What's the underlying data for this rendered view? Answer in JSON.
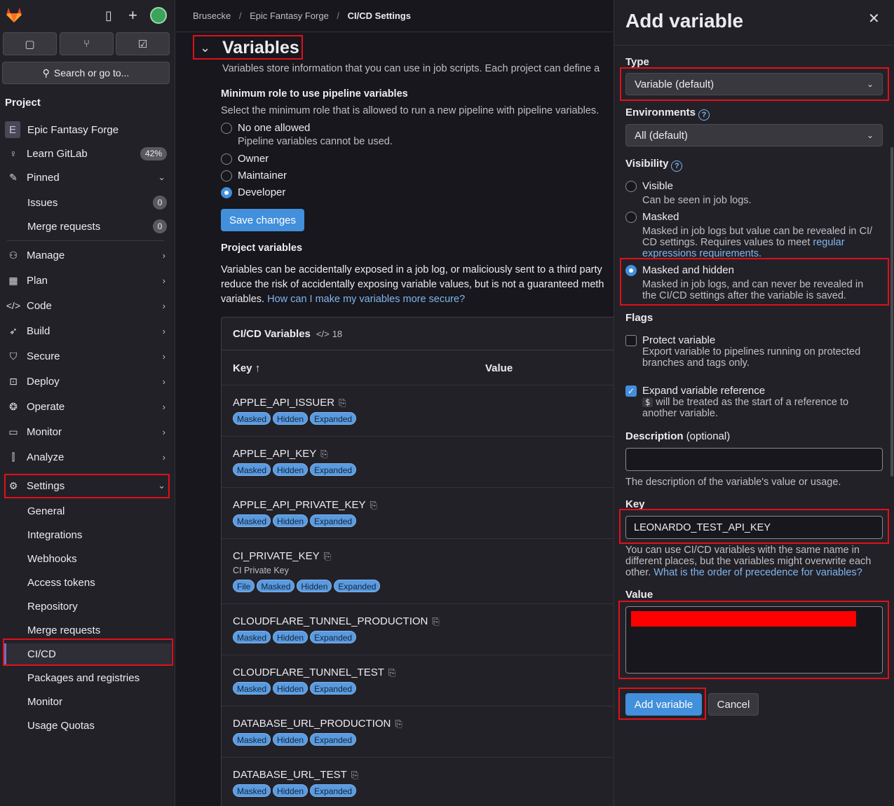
{
  "sidebar": {
    "search_label": "Search or go to...",
    "section_title": "Project",
    "project": {
      "initial": "E",
      "name": "Epic Fantasy Forge"
    },
    "learn": {
      "label": "Learn GitLab",
      "percent": "42%"
    },
    "pinned": {
      "label": "Pinned",
      "items": [
        {
          "label": "Issues",
          "count": "0"
        },
        {
          "label": "Merge requests",
          "count": "0"
        }
      ]
    },
    "nav": [
      "Manage",
      "Plan",
      "Code",
      "Build",
      "Secure",
      "Deploy",
      "Operate",
      "Monitor",
      "Analyze"
    ],
    "settings": {
      "label": "Settings",
      "items": [
        "General",
        "Integrations",
        "Webhooks",
        "Access tokens",
        "Repository",
        "Merge requests",
        "CI/CD",
        "Packages and registries",
        "Monitor",
        "Usage Quotas"
      ]
    }
  },
  "breadcrumb": {
    "items": [
      "Brusecke",
      "Epic Fantasy Forge",
      "CI/CD Settings"
    ]
  },
  "variables_section": {
    "title": "Variables",
    "description": "Variables store information that you can use in job scripts. Each project can define a",
    "min_role": {
      "title": "Minimum role to use pipeline variables",
      "description": "Select the minimum role that is allowed to run a new pipeline with pipeline variables.",
      "options": [
        {
          "label": "No one allowed",
          "help": "Pipeline variables cannot be used.",
          "selected": false
        },
        {
          "label": "Owner",
          "selected": false
        },
        {
          "label": "Maintainer",
          "selected": false
        },
        {
          "label": "Developer",
          "selected": true
        }
      ],
      "save_label": "Save changes"
    },
    "project_vars": {
      "title": "Project variables",
      "line1": "Variables can be accidentally exposed in a job log, or maliciously sent to a third party",
      "line2": "reduce the risk of accidentally exposing variable values, but is not a guaranteed meth",
      "line3_prefix": "variables.",
      "link": "How can I make my variables more secure?"
    },
    "table": {
      "title": "CI/CD Variables",
      "count": "18",
      "col_key": "Key",
      "col_value": "Value",
      "rows": [
        {
          "key": "APPLE_API_ISSUER",
          "badges": [
            "Masked",
            "Hidden",
            "Expanded"
          ]
        },
        {
          "key": "APPLE_API_KEY",
          "badges": [
            "Masked",
            "Hidden",
            "Expanded"
          ]
        },
        {
          "key": "APPLE_API_PRIVATE_KEY",
          "badges": [
            "Masked",
            "Hidden",
            "Expanded"
          ]
        },
        {
          "key": "CI_PRIVATE_KEY",
          "desc": "CI Private Key",
          "badges": [
            "File",
            "Masked",
            "Hidden",
            "Expanded"
          ]
        },
        {
          "key": "CLOUDFLARE_TUNNEL_PRODUCTION",
          "badges": [
            "Masked",
            "Hidden",
            "Expanded"
          ]
        },
        {
          "key": "CLOUDFLARE_TUNNEL_TEST",
          "badges": [
            "Masked",
            "Hidden",
            "Expanded"
          ]
        },
        {
          "key": "DATABASE_URL_PRODUCTION",
          "badges": [
            "Masked",
            "Hidden",
            "Expanded"
          ]
        },
        {
          "key": "DATABASE_URL_TEST",
          "badges": [
            "Masked",
            "Hidden",
            "Expanded"
          ]
        }
      ]
    }
  },
  "drawer": {
    "title": "Add variable",
    "type_label": "Type",
    "type_value": "Variable (default)",
    "env_label": "Environments",
    "env_value": "All (default)",
    "visibility_label": "Visibility",
    "vis_visible": {
      "label": "Visible",
      "help": "Can be seen in job logs."
    },
    "vis_masked": {
      "label": "Masked",
      "help1": "Masked in job logs but value can be revealed in CI/",
      "help2": "CD settings. Requires values to meet ",
      "link1": "regular",
      "link2": "expressions requirements."
    },
    "vis_hidden": {
      "label": "Masked and hidden",
      "help1": "Masked in job logs, and can never be revealed in",
      "help2": "the CI/CD settings after the variable is saved."
    },
    "flags_label": "Flags",
    "protect": {
      "label": "Protect variable",
      "help1": "Export variable to pipelines running on protected",
      "help2": "branches and tags only."
    },
    "expand": {
      "label": "Expand variable reference",
      "code": "$",
      "help1": " will be treated as the start of a reference to",
      "help2": "another variable."
    },
    "desc_label": "Description",
    "desc_optional": "(optional)",
    "desc_help": "The description of the variable's value or usage.",
    "key_label": "Key",
    "key_value": "LEONARDO_TEST_API_KEY",
    "key_help1": "You can use CI/CD variables with the same name in",
    "key_help2": "different places, but the variables might overwrite each",
    "key_help3_prefix": "other.",
    "key_help3_link": "What is the order of precedence for variables?",
    "value_label": "Value",
    "add_label": "Add variable",
    "cancel_label": "Cancel"
  },
  "colors": {
    "accent": "#428fdc",
    "annotation": "#e0101b",
    "redaction": "#ff0000"
  }
}
